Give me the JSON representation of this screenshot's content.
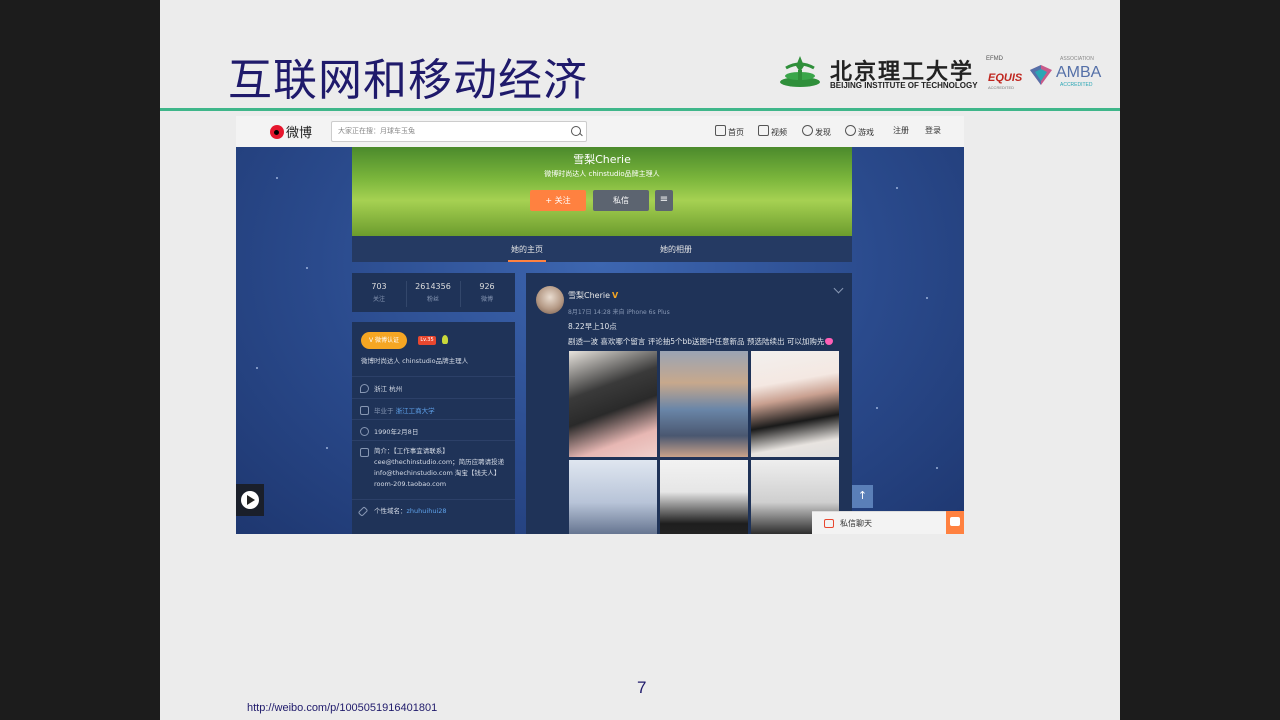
{
  "slide": {
    "title": "互联网和移动经济",
    "page_number": "7",
    "source_url": "http://weibo.com/p/1005051916401801",
    "logos": {
      "univ_cn": "北京理工大学",
      "univ_en": "BEIJING INSTITUTE OF TECHNOLOGY",
      "efmd": "EFMD",
      "equis": "EQUIS",
      "equis_accredited": "ACCREDITED",
      "amba_assoc": "ASSOCIATION",
      "amba": "AMBA",
      "amba_accredited": "ACCREDITED"
    }
  },
  "weibo": {
    "logo_text": "微博",
    "search_placeholder": "大家正在搜：月球车玉兔",
    "nav": {
      "home": "首页",
      "video": "视频",
      "discover": "发现",
      "game": "游戏",
      "register": "注册",
      "login": "登录"
    },
    "profile": {
      "name": "雪梨Cherie",
      "bio": "微博时尚达人 chinstudio品牌主理人",
      "follow_button": "+ 关注",
      "message_button": "私信",
      "more_button": "≡"
    },
    "tabs": {
      "home": "她的主页",
      "album": "她的相册"
    },
    "stats": [
      {
        "value": "703",
        "label": "关注"
      },
      {
        "value": "2614356",
        "label": "粉丝"
      },
      {
        "value": "926",
        "label": "微博"
      }
    ],
    "info": {
      "verified_badge": "V 微博认证",
      "level_badge": "Lv.35",
      "verified_text": "微博时尚达人 chinstudio品牌主理人",
      "location": "浙江 杭州",
      "school_prefix": "毕业于",
      "school": "浙江工商大学",
      "birthday": "1990年2月8日",
      "intro_label": "简介：",
      "intro_line1": "【工作事宜请联系】",
      "intro_line2": "cee@thechinstudio.com；简历应聘请投递",
      "intro_line3": "info@thechinstudio.com 淘宝【钱夫人】",
      "intro_line4": "room-209.taobao.com",
      "domain_label": "个性域名：",
      "domain": "zhuhuihui28"
    },
    "post": {
      "author": "雪梨Cherie",
      "meta": "8月17日 14:28 来自 iPhone 6s Plus",
      "line1": "8.22早上10点",
      "line2": "剧透一波 喜欢哪个留言 评论抽5个bb送图中任意新品 预选陆续出 可以加购先"
    },
    "chat_text": "私信聊天",
    "back_top": "↑"
  }
}
